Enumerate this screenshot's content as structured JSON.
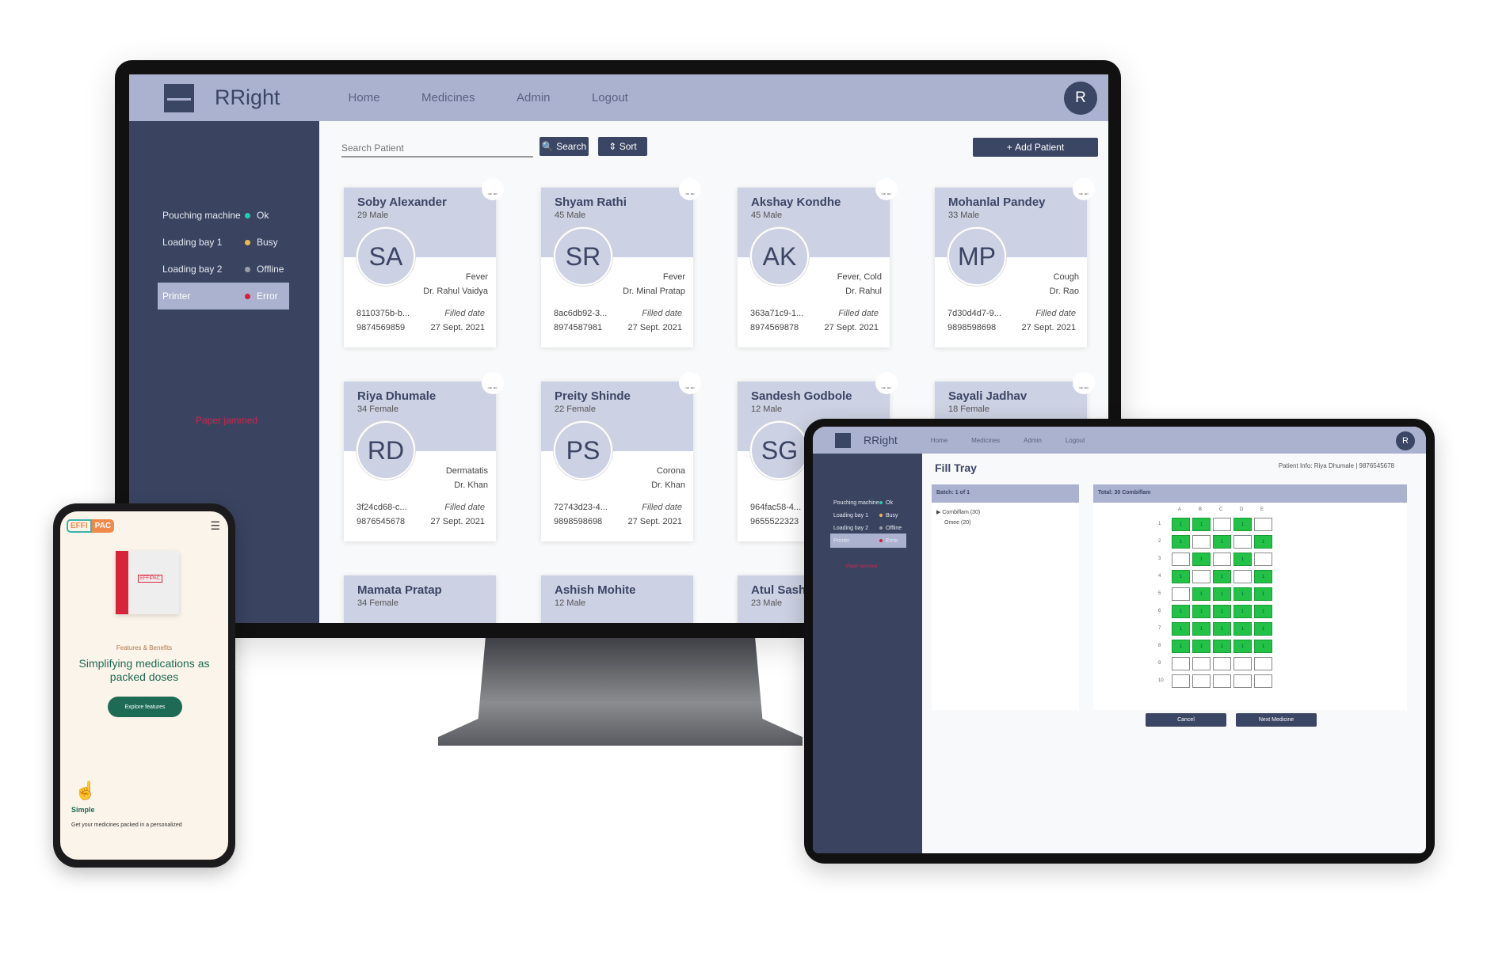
{
  "monitor": {
    "brand": "RRight",
    "nav": [
      "Home",
      "Medicines",
      "Admin",
      "Logout"
    ],
    "avatar_initial": "R",
    "sidebar": {
      "items": [
        {
          "label": "Pouching machine",
          "status": "Ok",
          "color": "#1fd1b0"
        },
        {
          "label": "Loading bay 1",
          "status": "Busy",
          "color": "#f2b84b"
        },
        {
          "label": "Loading bay 2",
          "status": "Offline",
          "color": "#9a9ea8"
        },
        {
          "label": "Printer",
          "status": "Error",
          "color": "#e0183f",
          "selected": true
        }
      ],
      "error_message": "Paper jammed"
    },
    "toolbar": {
      "search_placeholder": "Search Patient",
      "search_label": "Search",
      "sort_label": "Sort",
      "add_label": "Add Patient"
    },
    "filled_label": "Filled date",
    "patients": [
      {
        "name": "Soby Alexander",
        "age_gender": "29 Male",
        "initials": "SA",
        "diagnosis": "Fever",
        "doctor": "Dr. Rahul Vaidya",
        "id": "8110375b-b...",
        "phone": "9874569859",
        "date": "27 Sept. 2021"
      },
      {
        "name": "Shyam Rathi",
        "age_gender": "45 Male",
        "initials": "SR",
        "diagnosis": "Fever",
        "doctor": "Dr. Minal Pratap",
        "id": "8ac6db92-3...",
        "phone": "8974587981",
        "date": "27 Sept. 2021"
      },
      {
        "name": "Akshay Kondhe",
        "age_gender": "45 Male",
        "initials": "AK",
        "diagnosis": "Fever, Cold",
        "doctor": "Dr. Rahul",
        "id": "363a71c9-1...",
        "phone": "8974569878",
        "date": "27 Sept. 2021"
      },
      {
        "name": "Mohanlal Pandey",
        "age_gender": "33 Male",
        "initials": "MP",
        "diagnosis": "Cough",
        "doctor": "Dr. Rao",
        "id": "7d30d4d7-9...",
        "phone": "9898598698",
        "date": "27 Sept. 2021"
      },
      {
        "name": "Riya Dhumale",
        "age_gender": "34 Female",
        "initials": "RD",
        "diagnosis": "Dermatatis",
        "doctor": "Dr. Khan",
        "id": "3f24cd68-c...",
        "phone": "9876545678",
        "date": "27 Sept. 2021"
      },
      {
        "name": "Preity Shinde",
        "age_gender": "22 Female",
        "initials": "PS",
        "diagnosis": "Corona",
        "doctor": "Dr. Khan",
        "id": "72743d23-4...",
        "phone": "9898598698",
        "date": "27 Sept. 2021"
      },
      {
        "name": "Sandesh Godbole",
        "age_gender": "12 Male",
        "initials": "SG",
        "diagnosis": "",
        "doctor": "",
        "id": "964fac58-4...",
        "phone": "9655522323",
        "date": ""
      },
      {
        "name": "Sayali Jadhav",
        "age_gender": "18 Female",
        "initials": "",
        "diagnosis": "",
        "doctor": "",
        "id": "",
        "phone": "",
        "date": ""
      },
      {
        "name": "Mamata Pratap",
        "age_gender": "34 Female",
        "initials": "",
        "diagnosis": "",
        "doctor": "",
        "id": "",
        "phone": "",
        "date": ""
      },
      {
        "name": "Ashish Mohite",
        "age_gender": "12 Male",
        "initials": "",
        "diagnosis": "",
        "doctor": "",
        "id": "",
        "phone": "",
        "date": ""
      },
      {
        "name": "Atul Sashik",
        "age_gender": "23 Male",
        "initials": "",
        "diagnosis": "",
        "doctor": "",
        "id": "",
        "phone": "",
        "date": ""
      }
    ]
  },
  "tablet": {
    "brand": "RRight",
    "nav": [
      "Home",
      "Medicines",
      "Admin",
      "Logout"
    ],
    "avatar_initial": "R",
    "title": "Fill Tray",
    "patient_info": "Patient Info: Riya Dhumale | 9876545678",
    "batch_label": "Batch: 1 of 1",
    "total_label": "Total: 30 Combiflam",
    "medicines": [
      "Combiflam (30)",
      "Omee (20)"
    ],
    "columns": [
      "A",
      "B",
      "C",
      "D",
      "E"
    ],
    "rows": [
      "1",
      "2",
      "3",
      "4",
      "5",
      "6",
      "7",
      "8",
      "9",
      "10"
    ],
    "tray": [
      [
        1,
        1,
        0,
        1,
        0
      ],
      [
        1,
        0,
        1,
        0,
        1
      ],
      [
        0,
        1,
        0,
        1,
        0
      ],
      [
        1,
        0,
        1,
        0,
        1
      ],
      [
        0,
        1,
        1,
        1,
        1
      ],
      [
        1,
        1,
        1,
        1,
        1
      ],
      [
        1,
        1,
        1,
        1,
        1
      ],
      [
        1,
        1,
        1,
        1,
        1
      ],
      [
        0,
        0,
        0,
        0,
        0
      ],
      [
        0,
        0,
        0,
        0,
        0
      ]
    ],
    "cancel_label": "Cancel",
    "next_label": "Next Medicine"
  },
  "phone": {
    "logo_left": "EFFI",
    "logo_right": "PAC",
    "product_label": "EFFIPAC",
    "eyebrow": "Features & Benefits",
    "headline": "Simplifying medications as packed doses",
    "cta": "Explore features",
    "feature_title": "Simple",
    "feature_text": "Get your medicines packed in a personalized"
  }
}
